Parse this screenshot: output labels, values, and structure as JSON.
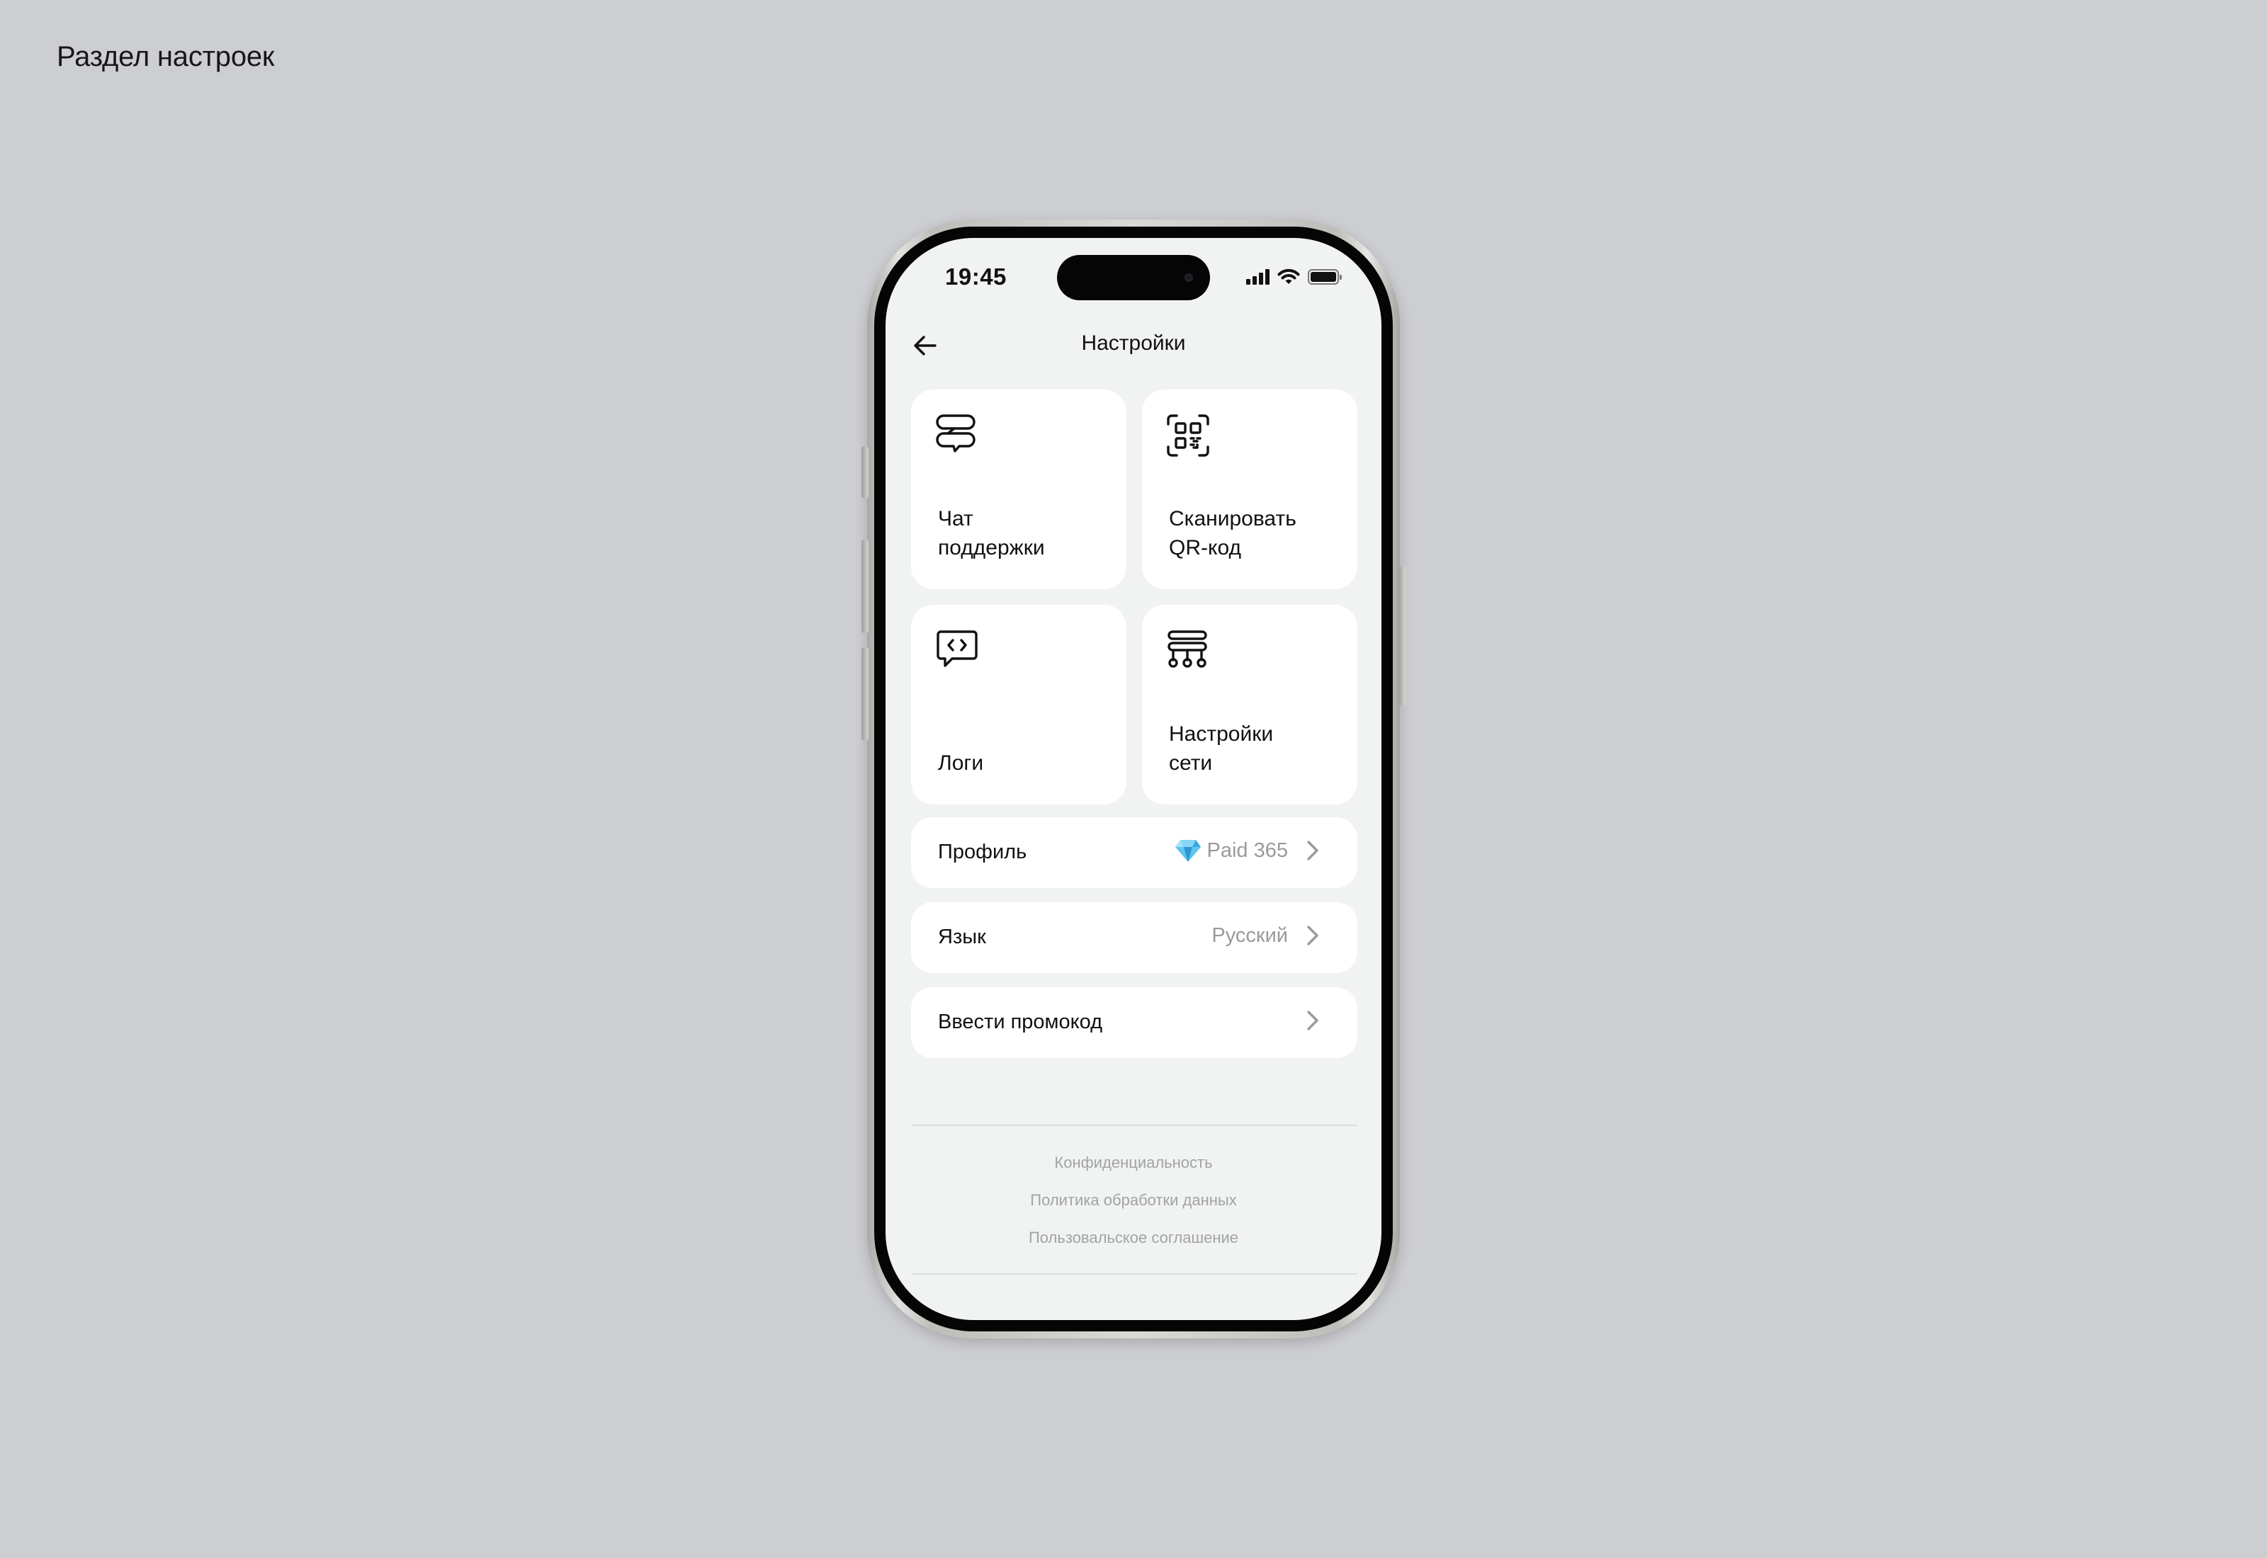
{
  "page": {
    "heading": "Раздел настроек"
  },
  "status_bar": {
    "time": "19:45",
    "icons": [
      "cellular-signal-icon",
      "wifi-icon",
      "battery-icon"
    ]
  },
  "nav": {
    "title": "Настройки",
    "back_icon": "arrow-left-icon"
  },
  "tiles": [
    {
      "label": "Чат\nподдержки",
      "icon": "support-chat-icon"
    },
    {
      "label": "Сканировать\nQR-код",
      "icon": "qr-scan-icon"
    },
    {
      "label": "Логи",
      "icon": "code-message-icon"
    },
    {
      "label": "Настройки\nсети",
      "icon": "network-tree-icon"
    }
  ],
  "rows": [
    {
      "label": "Профиль",
      "value": "Paid 365",
      "icon": "gem-icon"
    },
    {
      "label": "Язык",
      "value": "Русский"
    },
    {
      "label": "Ввести промокод",
      "value": ""
    }
  ],
  "footer": {
    "links": [
      "Конфиденциальность",
      "Политика обработки данных",
      "Пользовальское соглашение"
    ]
  },
  "colors": {
    "background": "#cdced2",
    "screen": "#f1f2f2",
    "card": "#ffffff",
    "muted_text": "#9a9a9a",
    "gem": "#4fb6e8"
  }
}
